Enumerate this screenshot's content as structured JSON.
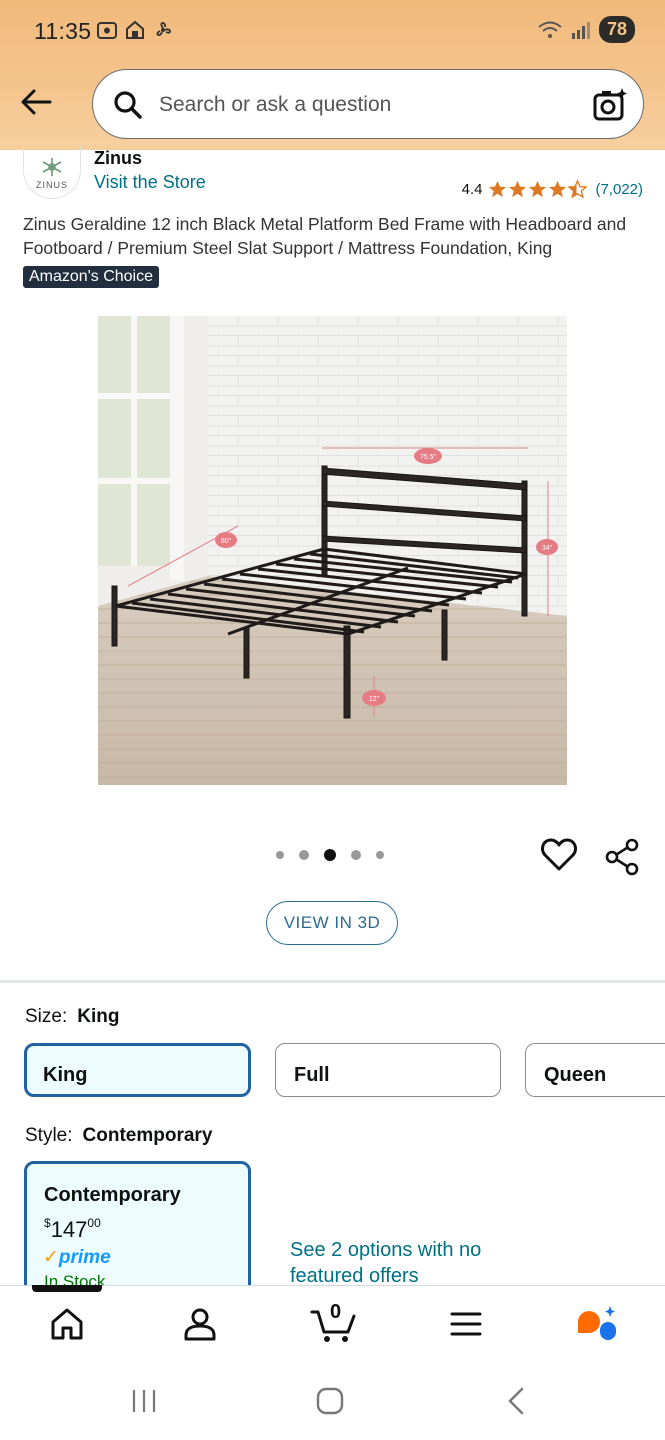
{
  "status_bar": {
    "time": "11:35",
    "battery": "78"
  },
  "search": {
    "placeholder": "Search or ask a question"
  },
  "brand": {
    "logo_text": "ZINUS",
    "name": "Zinus",
    "visit_store": "Visit the Store"
  },
  "rating": {
    "value": "4.4",
    "stars": 4.4,
    "count": "(7,022)"
  },
  "product": {
    "title": "Zinus Geraldine 12 inch Black Metal Platform Bed Frame with Headboard and Footboard / Premium Steel Slat Support / Mattress Foundation, King",
    "badge": "Amazon's Choice",
    "image_dims": {
      "width": "75.5\"",
      "length": "80\"",
      "head_height": "34\"",
      "clearance": "12\""
    },
    "gallery": {
      "count": 5,
      "active_index": 2
    },
    "view_3d": "VIEW IN 3D"
  },
  "size": {
    "label": "Size:",
    "selected": "King",
    "options": [
      "King",
      "Full",
      "Queen"
    ]
  },
  "style": {
    "label": "Style:",
    "selected": "Contemporary",
    "card": {
      "name": "Contemporary",
      "price_symbol": "$",
      "price_whole": "147",
      "price_fraction": "00",
      "prime": "prime",
      "stock": "In Stock"
    },
    "more_options": "See 2 options with no featured offers"
  },
  "bottom_nav": {
    "items": [
      "home-icon",
      "account-icon",
      "cart-icon",
      "menu-icon",
      "rufus-icon"
    ],
    "cart_count": "0"
  },
  "colors": {
    "header": "#f5c58e",
    "link": "#007185",
    "selected_border": "#2162a1",
    "star": "#de7921",
    "prime_blue": "#1399ff"
  }
}
